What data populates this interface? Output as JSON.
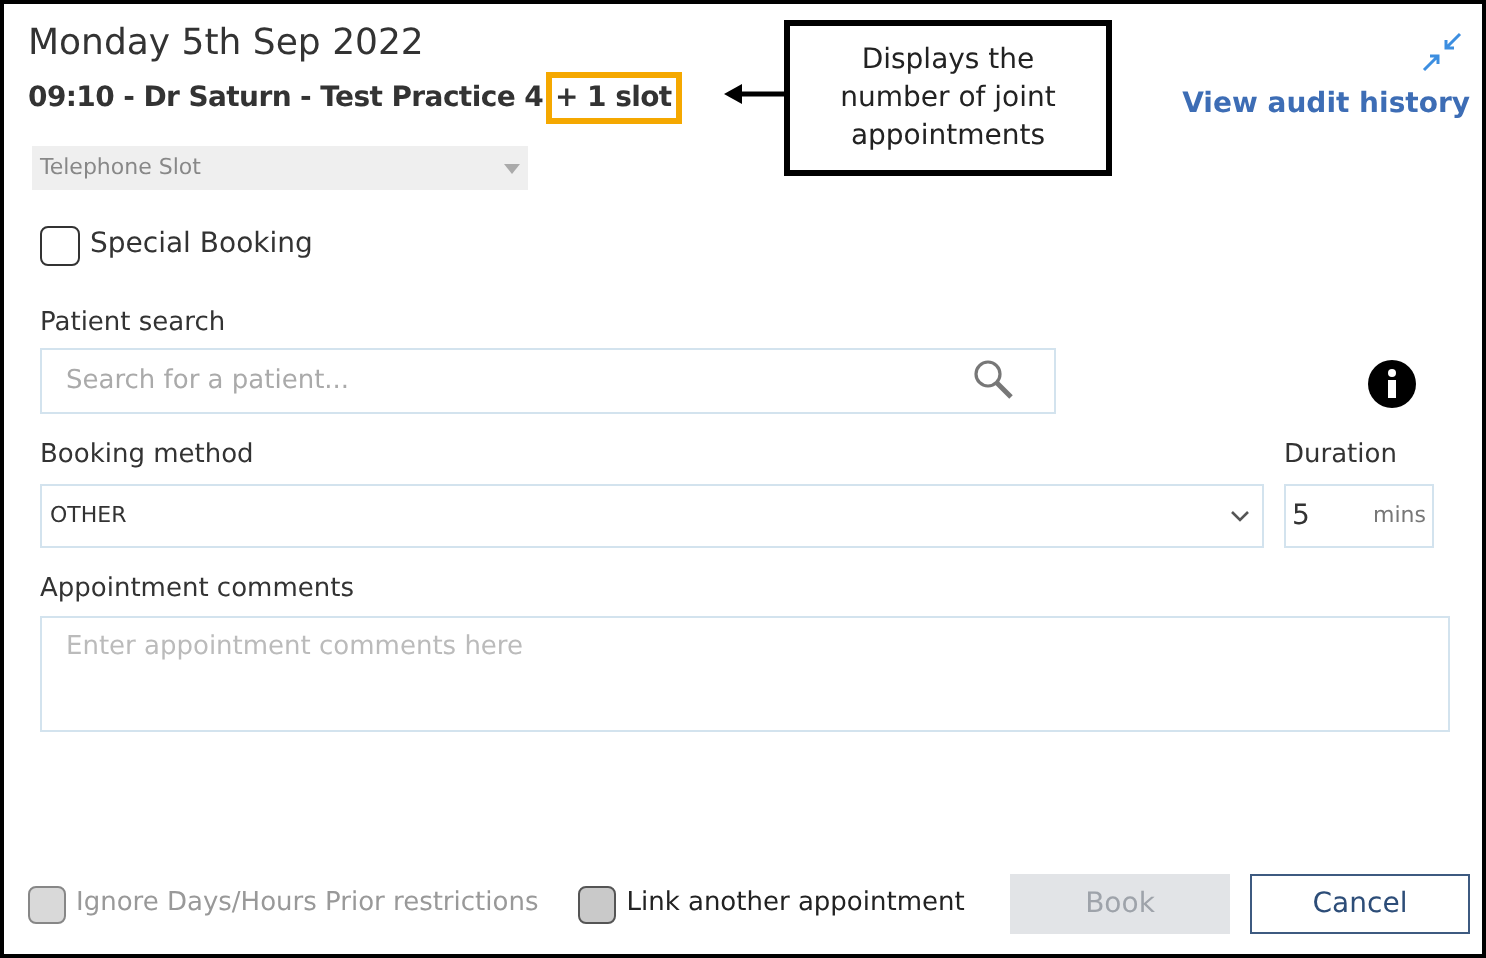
{
  "header": {
    "title": "Monday 5th Sep 2022",
    "subtitle": "09:10 - Dr Saturn - Test Practice 4",
    "slot_count": "+ 1 slot",
    "audit_link": "View audit history"
  },
  "callout": {
    "text": "Displays the number of joint appointments"
  },
  "slot_type": {
    "value": "Telephone Slot",
    "disabled": true
  },
  "special_booking": {
    "label": "Special Booking",
    "checked": false
  },
  "patient_search": {
    "label": "Patient search",
    "placeholder": "Search for a patient..."
  },
  "booking_method": {
    "label": "Booking method",
    "value": "OTHER"
  },
  "duration": {
    "label": "Duration",
    "value": "5",
    "unit": "mins"
  },
  "comments": {
    "label": "Appointment comments",
    "placeholder": "Enter appointment comments here"
  },
  "footer_options": [
    {
      "label": "Ignore Days/Hours Prior restrictions",
      "checked": false,
      "disabled": true
    },
    {
      "label": "Link another appointment",
      "checked": false,
      "disabled": false
    }
  ],
  "buttons": [
    {
      "label": "Book",
      "kind": "primary",
      "disabled": true
    },
    {
      "label": "Cancel",
      "kind": "secondary",
      "disabled": false
    }
  ]
}
